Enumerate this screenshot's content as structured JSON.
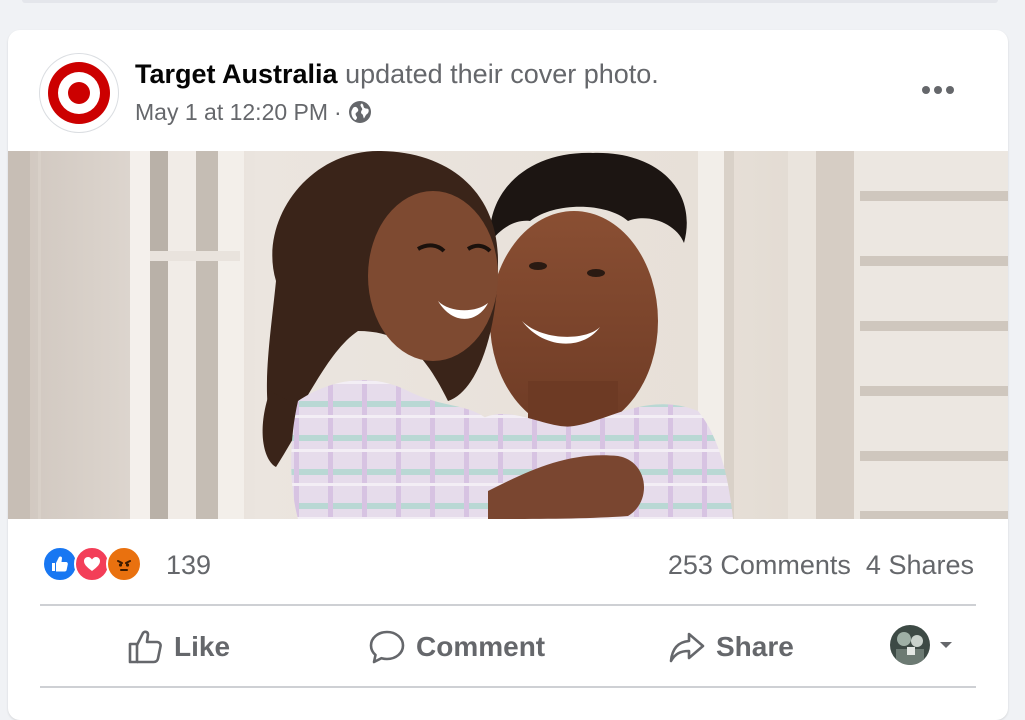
{
  "post": {
    "page_name": "Target Australia",
    "action_text": " updated their cover photo.",
    "timestamp": "May 1 at 12:20 PM",
    "separator": "·",
    "privacy_icon": "globe-icon"
  },
  "photo": {
    "kind": "cover-photo",
    "icons": [
      "target-logo-icon",
      "more-options-icon"
    ]
  },
  "reactions": {
    "types": [
      "like",
      "love",
      "angry"
    ],
    "count": "139",
    "comments": "253 Comments",
    "shares": "4 Shares"
  },
  "actions": {
    "like_label": "Like",
    "comment_label": "Comment",
    "share_label": "Share",
    "icons": [
      "thumbs-up-icon",
      "comment-bubble-icon",
      "share-arrow-icon",
      "caret-down-icon"
    ]
  },
  "colors": {
    "brand_red": "#cc0000",
    "like_blue": "#1877f2",
    "love_red": "#f33e58",
    "angry_orange": "#e9710f",
    "secondary_text": "#65676b",
    "primary_text": "#050505",
    "card_bg": "#ffffff",
    "page_bg": "#f0f2f5"
  }
}
